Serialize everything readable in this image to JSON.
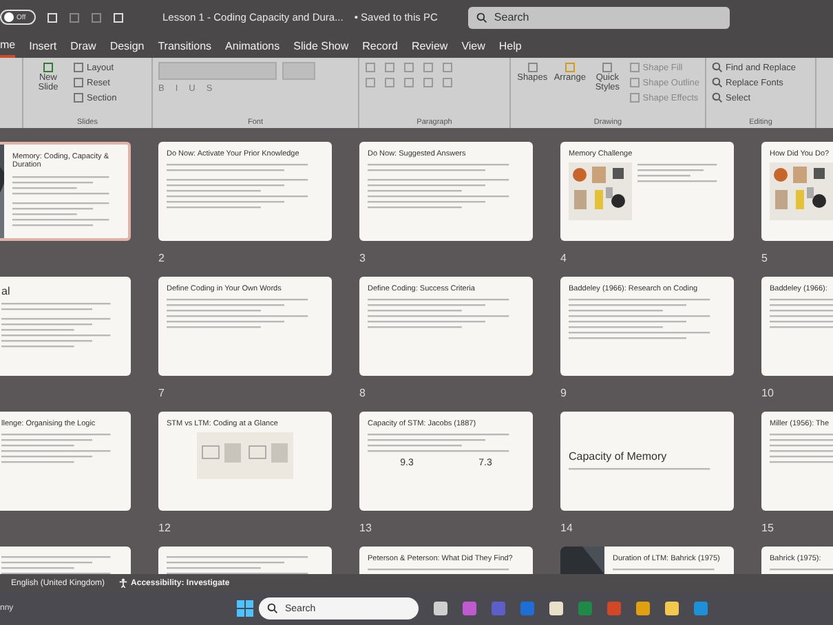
{
  "titlebar": {
    "autosave": {
      "label": "Off",
      "on": false
    },
    "title": "Lesson 1 - Coding Capacity and Dura...",
    "saved": "• Saved to this PC",
    "search": {
      "placeholder": "Search"
    }
  },
  "tabs": [
    {
      "label": "me",
      "selected": true
    },
    {
      "label": "Insert",
      "selected": false
    },
    {
      "label": "Draw",
      "selected": false
    },
    {
      "label": "Design",
      "selected": false
    },
    {
      "label": "Transitions",
      "selected": false
    },
    {
      "label": "Animations",
      "selected": false
    },
    {
      "label": "Slide Show",
      "selected": false
    },
    {
      "label": "Record",
      "selected": false
    },
    {
      "label": "Review",
      "selected": false
    },
    {
      "label": "View",
      "selected": false
    },
    {
      "label": "Help",
      "selected": false
    }
  ],
  "ribbon": [
    {
      "label": "Slides",
      "kind": "slides",
      "items": [
        "New Slide",
        "Layout",
        "Reset",
        "Section"
      ]
    },
    {
      "label": "Font",
      "kind": "font",
      "items": [
        "B",
        "I",
        "U",
        "S"
      ]
    },
    {
      "label": "Paragraph",
      "kind": "paragraph"
    },
    {
      "label": "Drawing",
      "kind": "drawing",
      "items": [
        "Shapes",
        "Arrange",
        "Quick Styles",
        "Shape Fill",
        "Shape Outline",
        "Shape Effects"
      ]
    },
    {
      "label": "Editing",
      "kind": "editing",
      "items": [
        "Find and Replace",
        "Replace Fonts",
        "Select"
      ]
    }
  ],
  "slides": [
    {
      "title": "Memory: Coding, Capacity & Duration",
      "kind": "image-left",
      "selected": true
    },
    {
      "number": "2",
      "title": "Do Now: Activate Your Prior Knowledge",
      "kind": "columns",
      "selected": false
    },
    {
      "number": "3",
      "title": "Do Now: Suggested Answers",
      "kind": "columns",
      "selected": false
    },
    {
      "number": "4",
      "title": "Memory Challenge",
      "kind": "picture",
      "selected": false
    },
    {
      "number": "5",
      "title": "How Did You Do?",
      "kind": "picture",
      "selected": false
    },
    {
      "title": "al",
      "kind": "columns",
      "selected": false
    },
    {
      "number": "7",
      "title": "Define Coding in Your Own Words",
      "kind": "text",
      "selected": false
    },
    {
      "number": "8",
      "title": "Define Coding: Success Criteria",
      "kind": "text",
      "selected": false
    },
    {
      "number": "9",
      "title": "Baddeley (1966): Research on Coding",
      "kind": "panel",
      "selected": false
    },
    {
      "number": "10",
      "title": "Baddeley (1966):",
      "kind": "text",
      "selected": false
    },
    {
      "title": "llenge: Organising the Logic",
      "kind": "text",
      "selected": false
    },
    {
      "number": "12",
      "title": "STM vs LTM: Coding at a Glance",
      "kind": "diagram",
      "selected": false
    },
    {
      "number": "13",
      "title": "Capacity of STM: Jacobs (1887)",
      "kind": "stats",
      "stats": [
        "9.3",
        "7.3"
      ],
      "selected": false
    },
    {
      "number": "14",
      "title": "Capacity of Memory",
      "kind": "section",
      "selected": false
    },
    {
      "number": "15",
      "title": "Miller (1956): The",
      "kind": "text",
      "selected": false
    },
    {
      "kind": "text",
      "selected": false
    },
    {
      "kind": "text",
      "selected": false
    },
    {
      "title": "Peterson & Peterson: What Did They Find?",
      "kind": "text",
      "selected": false
    },
    {
      "title": "Duration of LTM: Bahrick (1975)",
      "kind": "image-left",
      "selected": false
    },
    {
      "title": "Bahrick (1975):",
      "kind": "text",
      "selected": false
    }
  ],
  "status_bar": {
    "language": "English (United Kingdom)",
    "accessibility": "Accessibility: Investigate"
  },
  "taskbar": {
    "weather": "nny",
    "search": {
      "placeholder": "Search"
    }
  }
}
